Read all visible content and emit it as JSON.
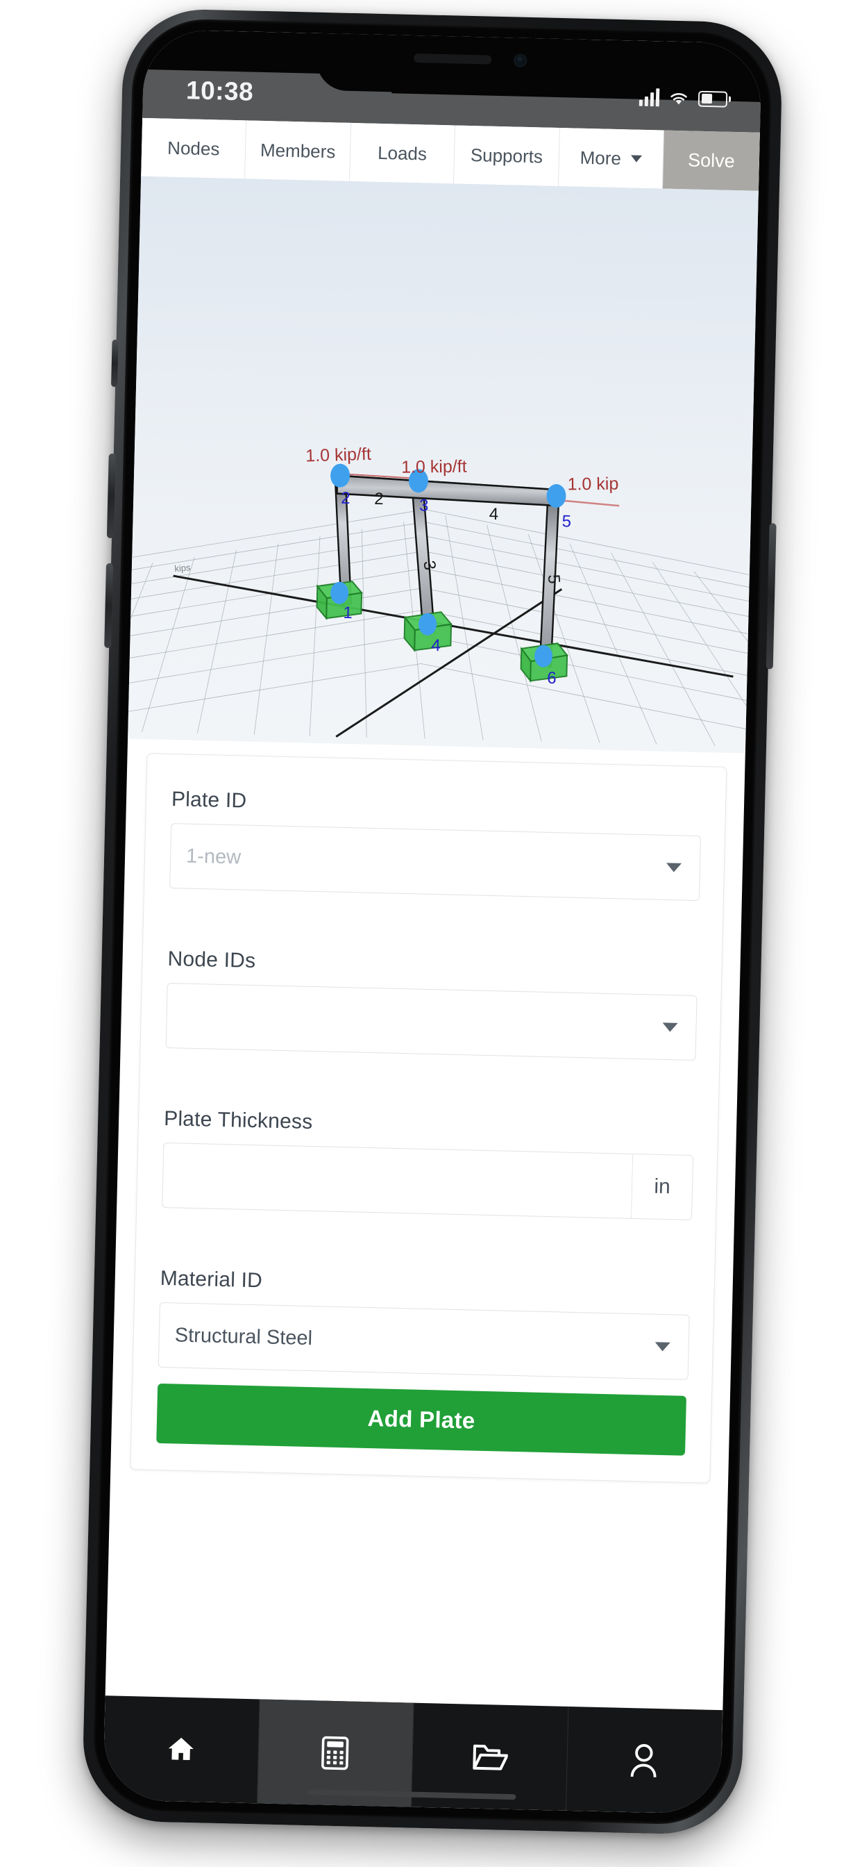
{
  "device": {
    "status_bar": {
      "time": "10:38",
      "signal_icon": "cellular-signal-icon",
      "wifi_icon": "wifi-icon",
      "battery_icon": "battery-icon"
    }
  },
  "app": {
    "tabs": [
      {
        "label": "Nodes",
        "name": "tab-nodes",
        "active": false
      },
      {
        "label": "Members",
        "name": "tab-members",
        "active": false
      },
      {
        "label": "Loads",
        "name": "tab-loads",
        "active": false
      },
      {
        "label": "Supports",
        "name": "tab-supports",
        "active": false
      },
      {
        "label": "More",
        "name": "tab-more",
        "active": false,
        "has_caret": true
      }
    ],
    "solve_label": "Solve"
  },
  "viewport": {
    "axis_label": "kips",
    "load_labels": [
      {
        "text": "1.0 kip/ft",
        "color": "#a63434"
      },
      {
        "text": "1.0 kip/ft",
        "color": "#a63434"
      },
      {
        "text": "1.0 kip",
        "color": "#a63434"
      }
    ],
    "node_labels": [
      "1",
      "2",
      "3",
      "4",
      "5",
      "6"
    ],
    "member_labels": [
      "2",
      "3",
      "4",
      "5"
    ],
    "colors": {
      "node_marker": "#3fa0ee",
      "support_cube": "#3fc04a",
      "member": "#b9bcc0",
      "load_text": "#a63434",
      "node_text": "#2222cc",
      "member_text": "#1a1a1a",
      "background_top": "#dfe7f0",
      "background_bottom": "#f2f5f8"
    }
  },
  "form": {
    "fields": [
      {
        "label": "Plate ID",
        "value": "",
        "placeholder": "1-new",
        "type": "select"
      },
      {
        "label": "Node IDs",
        "value": "",
        "placeholder": "",
        "type": "select"
      },
      {
        "label": "Plate Thickness",
        "value": "",
        "placeholder": "",
        "type": "text",
        "unit": "in"
      },
      {
        "label": "Material ID",
        "value": "Structural Steel",
        "placeholder": "",
        "type": "select"
      }
    ],
    "submit_label": "Add Plate",
    "submit_color": "#21a038"
  },
  "bottom_nav": [
    {
      "name": "nav-home",
      "icon": "home-icon",
      "active": false
    },
    {
      "name": "nav-calculator",
      "icon": "calculator-icon",
      "active": true
    },
    {
      "name": "nav-files",
      "icon": "folder-open-icon",
      "active": false
    },
    {
      "name": "nav-account",
      "icon": "user-icon",
      "active": false
    }
  ]
}
